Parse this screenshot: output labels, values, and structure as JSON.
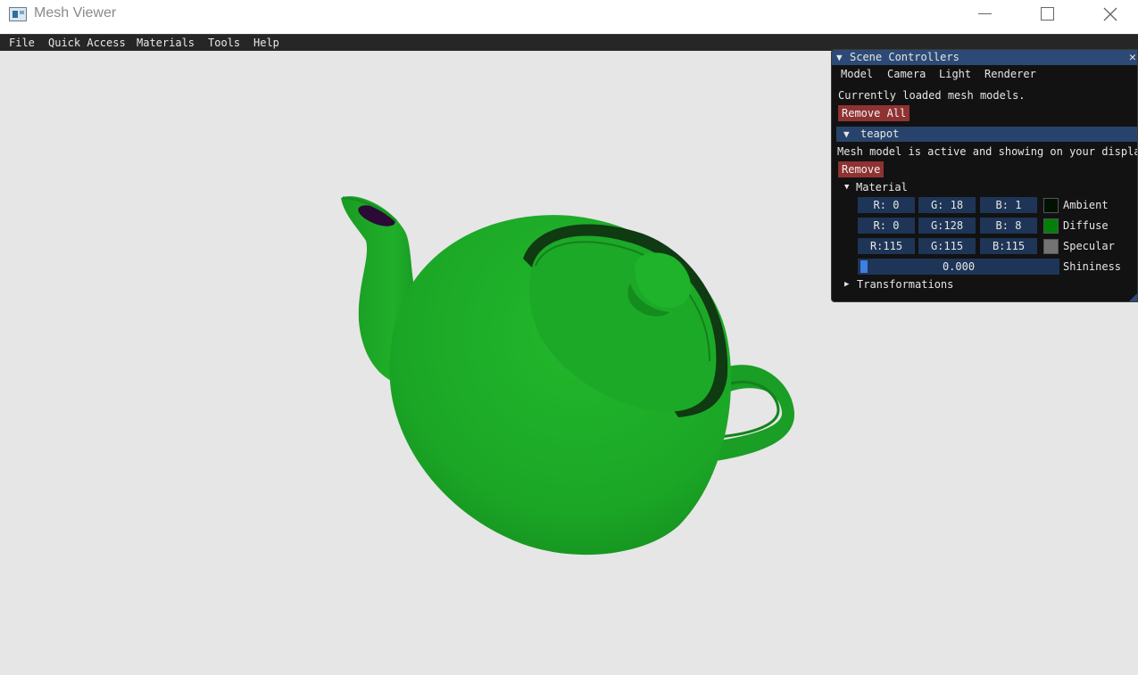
{
  "window": {
    "title": "Mesh Viewer"
  },
  "menu": [
    "File",
    "Quick Access",
    "Materials",
    "Tools",
    "Help"
  ],
  "panel": {
    "title": "Scene Controllers",
    "tabs": [
      "Model",
      "Camera",
      "Light",
      "Renderer"
    ],
    "loaded_text": "Currently loaded mesh models.",
    "remove_all_label": "Remove All",
    "model": {
      "name": "teapot",
      "status_text": "Mesh model is active and showing on your display",
      "remove_label": "Remove",
      "material_label": "Material",
      "material": [
        {
          "label": "Ambient",
          "r": "R:  0",
          "g": "G: 18",
          "b": "B:  1",
          "color": "#001201"
        },
        {
          "label": "Diffuse",
          "r": "R:  0",
          "g": "G:128",
          "b": "B:  8",
          "color": "#008008"
        },
        {
          "label": "Specular",
          "r": "R:115",
          "g": "G:115",
          "b": "B:115",
          "color": "#737373"
        }
      ],
      "shininess_label": "Shininess",
      "shininess_value": "0.000",
      "transformations_label": "Transformations"
    }
  },
  "colors": {
    "teapot": "#1fae2a",
    "background": "#e6e6e6",
    "panel_header": "#2c4a75",
    "button_red": "#8f3232"
  }
}
